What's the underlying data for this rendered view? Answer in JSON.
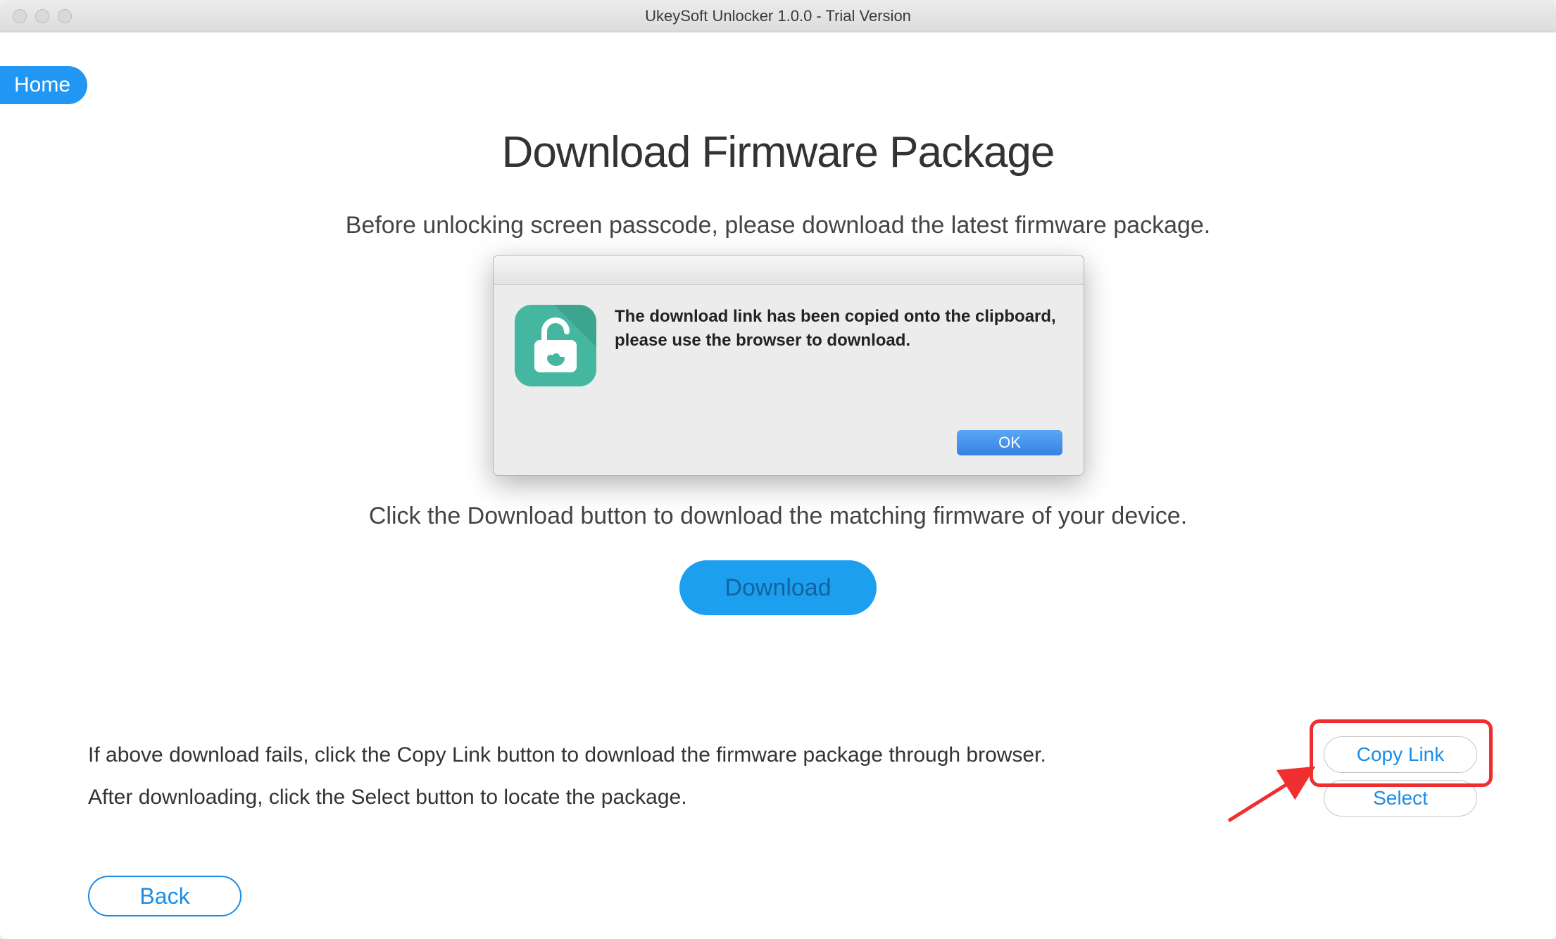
{
  "window": {
    "title": "UkeySoft Unlocker 1.0.0 - Trial Version"
  },
  "nav": {
    "home_label": "Home"
  },
  "main": {
    "heading": "Download Firmware Package",
    "subheading": "Before unlocking screen passcode, please download the latest firmware package.",
    "instruction": "Click the Download button to download the matching firmware of your device.",
    "download_label": "Download"
  },
  "fallback": {
    "line1": "If above download fails, click the Copy Link button to download the firmware package through browser.",
    "line2": "After downloading, click the Select button to locate the package.",
    "copy_link_label": "Copy Link",
    "select_label": "Select"
  },
  "footer": {
    "back_label": "Back"
  },
  "dialog": {
    "message": "The download link has been copied onto the clipboard,   please use the browser to download.",
    "ok_label": "OK"
  },
  "annotation": {
    "highlight_target": "copy-link-button"
  }
}
